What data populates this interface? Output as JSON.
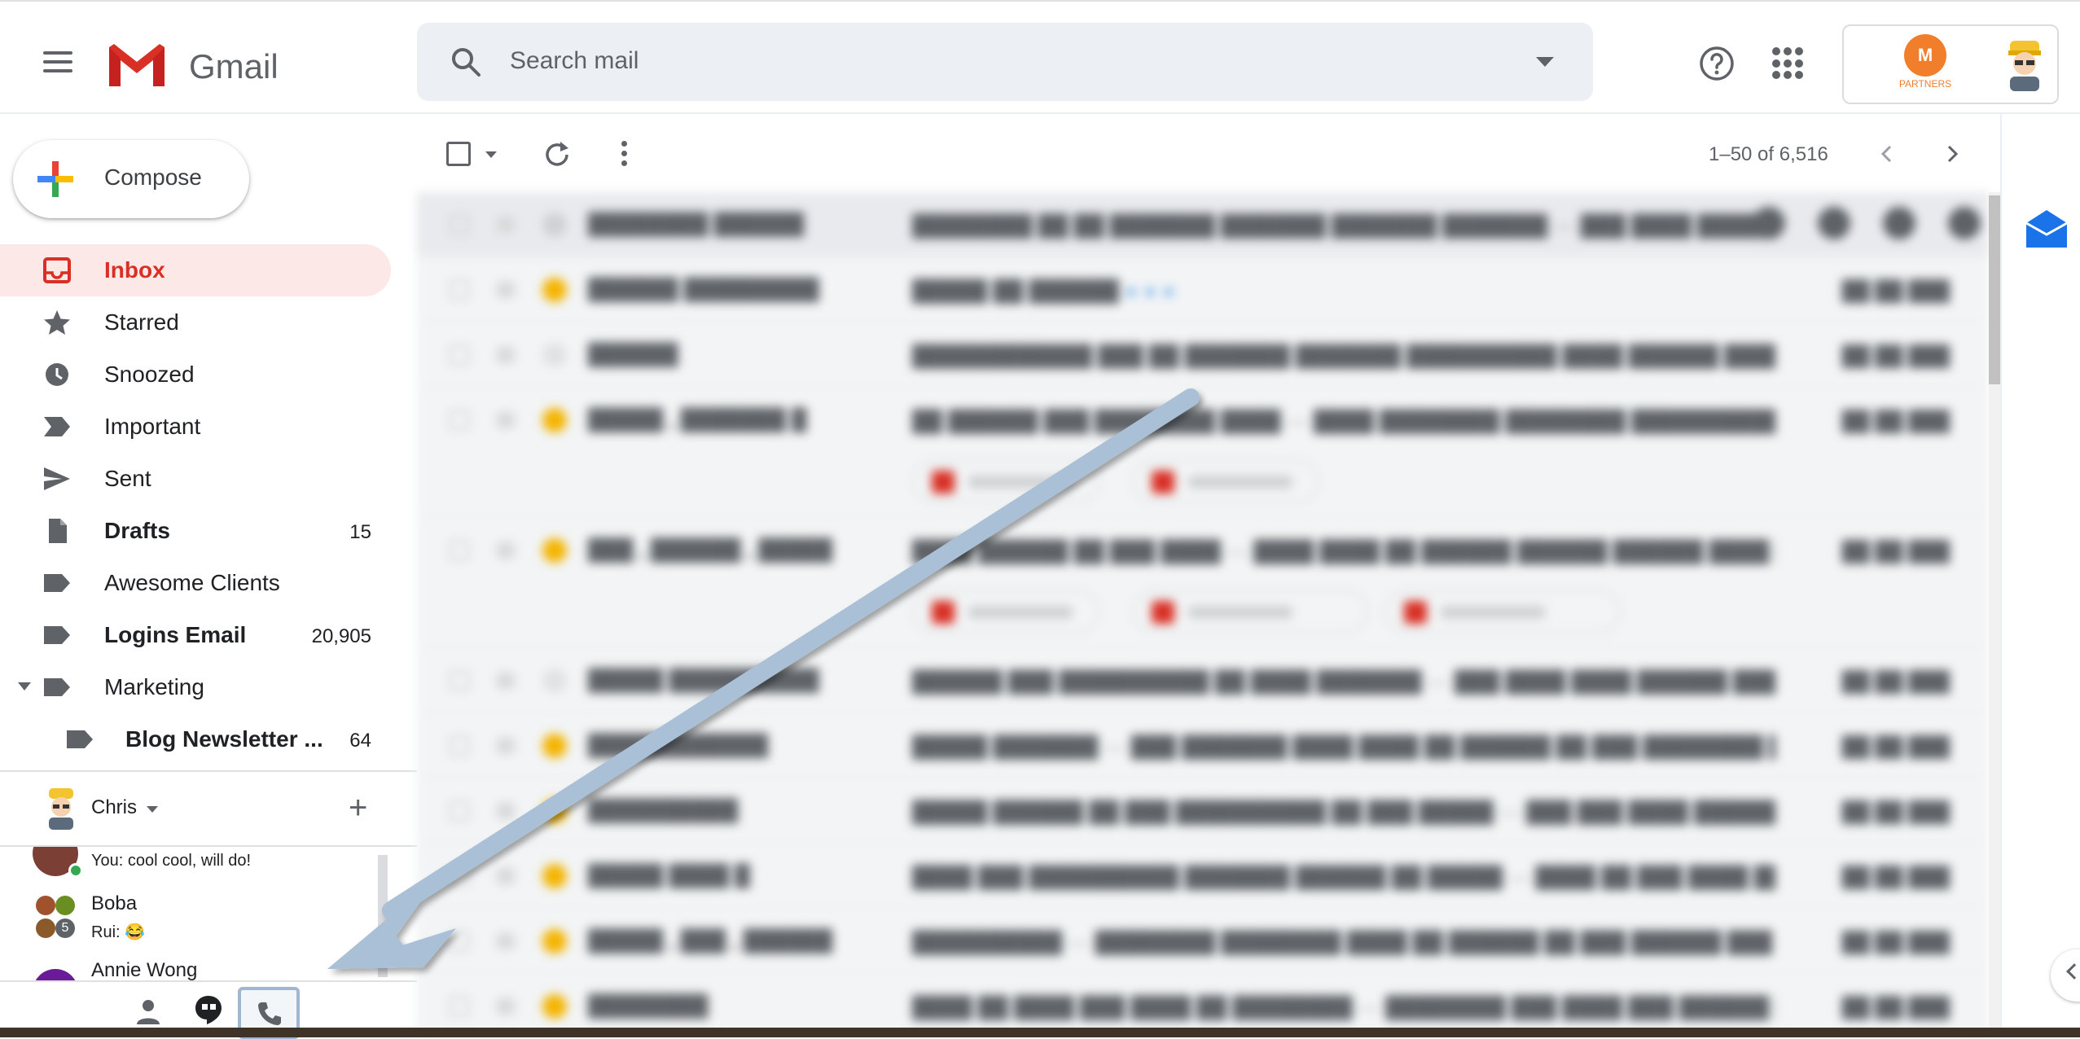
{
  "header": {
    "app_name": "Gmail",
    "search_placeholder": "Search mail",
    "partner_logo_text": "PARTNERS",
    "partner_logo_mark": "M"
  },
  "compose": {
    "label": "Compose"
  },
  "sidebar": {
    "items": [
      {
        "label": "Inbox",
        "count": "",
        "icon": "inbox-icon",
        "active": true
      },
      {
        "label": "Starred",
        "count": "",
        "icon": "star-icon"
      },
      {
        "label": "Snoozed",
        "count": "",
        "icon": "clock-icon"
      },
      {
        "label": "Important",
        "count": "",
        "icon": "important-icon"
      },
      {
        "label": "Sent",
        "count": "",
        "icon": "send-icon"
      },
      {
        "label": "Drafts",
        "count": "15",
        "icon": "draft-icon",
        "bold": true
      },
      {
        "label": "Awesome Clients",
        "count": "",
        "icon": "label-icon"
      },
      {
        "label": "Logins Email",
        "count": "20,905",
        "icon": "label-icon",
        "bold": true
      },
      {
        "label": "Marketing",
        "count": "",
        "icon": "label-icon",
        "expandable": true
      },
      {
        "label": "Blog Newsletter ...",
        "count": "64",
        "icon": "label-icon",
        "sub": true
      }
    ]
  },
  "hangouts": {
    "user": "Chris",
    "contacts": [
      {
        "name": "",
        "message": "You: cool cool, will do!"
      },
      {
        "name": "Boba",
        "message": "Rui: 😂",
        "badge": "5"
      },
      {
        "name": "Annie Wong",
        "message": ""
      }
    ]
  },
  "toolbar": {
    "pager": "1–50 of 6,516"
  },
  "colors": {
    "accent_red": "#d93025",
    "active_bg": "#fce8e6",
    "annotation_arrow": "#a9c0d6"
  }
}
